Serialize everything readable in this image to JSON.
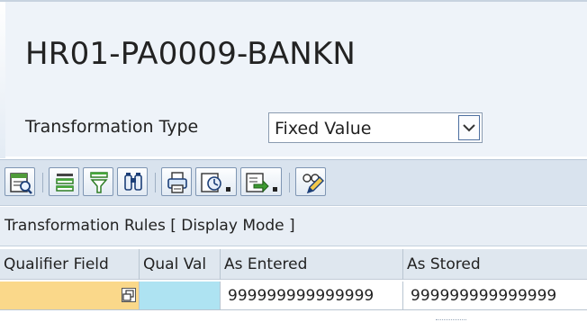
{
  "header": {
    "title": "HR01-PA0009-BANKN",
    "transformation_type_label": "Transformation Type",
    "transformation_type_value": "Fixed Value"
  },
  "toolbar": {
    "buttons": [
      {
        "icon": "details-icon"
      },
      {
        "icon": "align-top-icon"
      },
      {
        "icon": "filter-icon"
      },
      {
        "icon": "find-icon"
      },
      {
        "icon": "print-icon"
      },
      {
        "icon": "views-menu-icon"
      },
      {
        "icon": "export-menu-icon"
      },
      {
        "icon": "edit-glasses-icon"
      }
    ]
  },
  "section": {
    "title": "Transformation Rules [ Display Mode ]"
  },
  "table": {
    "columns": [
      "Qualifier Field",
      "Qual Val",
      "As Entered",
      "As Stored"
    ],
    "rows": [
      {
        "qualifier_field": "",
        "qual_val": "",
        "as_entered": "999999999999999",
        "as_stored": "999999999999999"
      }
    ]
  },
  "colors": {
    "qualifier_cell_bg": "#fad88a",
    "qualval_cell_bg": "#aee3f2",
    "toolbar_bg": "#d9e3ee",
    "header_bg": "#eef3f9"
  }
}
